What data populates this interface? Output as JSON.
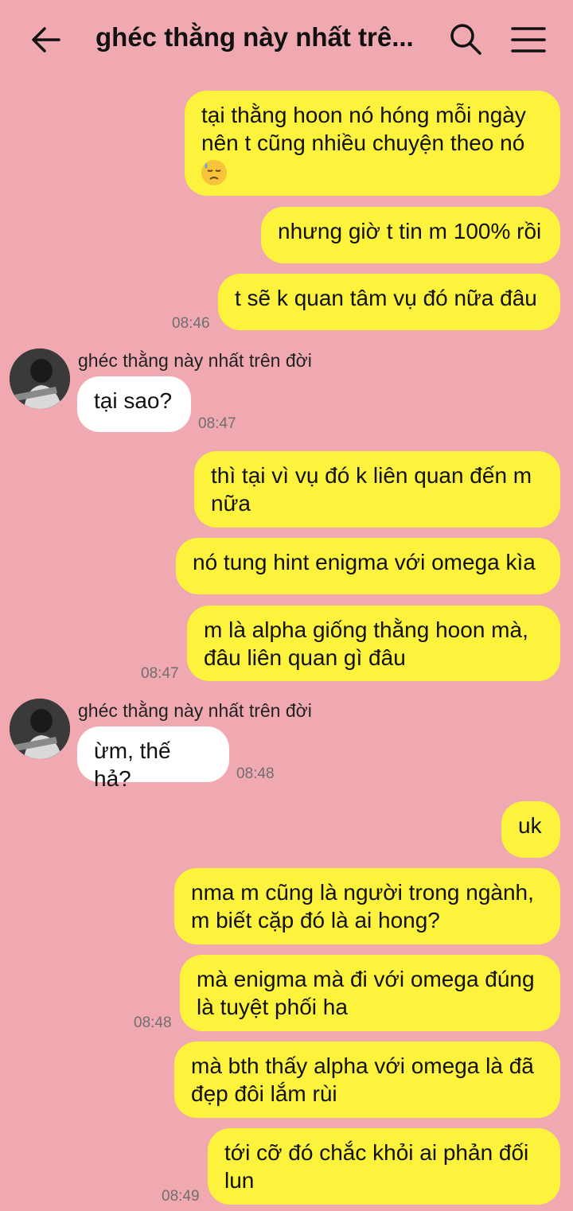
{
  "header": {
    "back_icon": "arrow-left-icon",
    "title": "ghéc thằng này nhất trê...",
    "search_icon": "search-icon",
    "menu_icon": "hamburger-menu-icon"
  },
  "colors": {
    "background": "#f0a9b1",
    "my_bubble": "#fef33c",
    "their_bubble": "#ffffff"
  },
  "messages": [
    {
      "text1": "tại thằng hoon nó hóng mỗi ngày",
      "text2": "nên t cũng nhiều chuyện theo nó",
      "emoji": "downcast-sweat-face"
    },
    {
      "text": "nhưng giờ t tin m 100% rồi"
    },
    {
      "text": "t sẽ k quan tâm vụ đó nữa đâu",
      "time": "08:46"
    },
    {
      "sender": "ghéc thằng này nhất trên đời",
      "text": "tại sao?",
      "time": "08:47"
    },
    {
      "text1": "thì tại vì vụ đó k liên quan đến m",
      "text2": "nữa"
    },
    {
      "text": "nó tung hint enigma với omega kìa"
    },
    {
      "text1": "m là alpha giống thằng hoon mà,",
      "text2": "đâu liên quan gì đâu",
      "time": "08:47"
    },
    {
      "sender": "ghéc thằng này nhất trên đời",
      "text": "ừm, thế hả?",
      "time": "08:48"
    },
    {
      "text": "uk"
    },
    {
      "text1": "nma m cũng là người trong ngành,",
      "text2": "m biết cặp đó là ai hong?"
    },
    {
      "text1": "mà enigma mà đi với omega đúng",
      "text2": "là tuyệt phối ha",
      "time": "08:48"
    },
    {
      "text1": "mà bth thấy alpha với omega là đã",
      "text2": "đẹp đôi lắm rùi"
    },
    {
      "text1": "tới cỡ đó chắc khỏi ai phản đối",
      "text2": "lun",
      "time": "08:49"
    }
  ]
}
